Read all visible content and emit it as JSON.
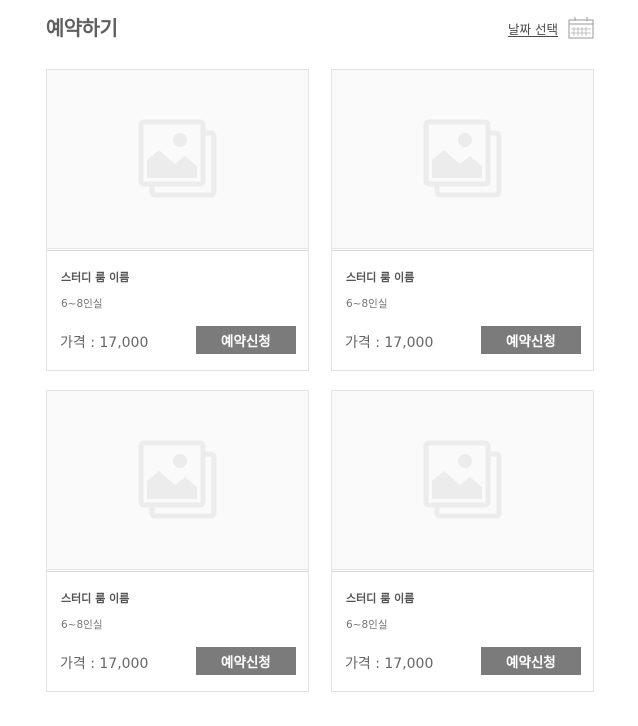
{
  "page": {
    "title": "예약하기",
    "date_select_label": "날짜 선택"
  },
  "icons": {
    "calendar": "calendar-icon",
    "image_placeholder": "image-placeholder-icon"
  },
  "colors": {
    "button_bg": "#7b7b7b",
    "button_text": "#ffffff",
    "title": "#5f5f5f",
    "card_border": "#e3e3e3",
    "image_bg": "#fafafa"
  },
  "rooms": [
    {
      "name": "스터디 룸 이름",
      "capacity": "6~8인실",
      "price": "가격 : 17,000",
      "button": "예약신청"
    },
    {
      "name": "스터디 룸 이름",
      "capacity": "6~8인실",
      "price": "가격 : 17,000",
      "button": "예약신청"
    },
    {
      "name": "스터디 룸 이름",
      "capacity": "6~8인실",
      "price": "가격 : 17,000",
      "button": "예약신청"
    },
    {
      "name": "스터디 룸 이름",
      "capacity": "6~8인실",
      "price": "가격 : 17,000",
      "button": "예약신청"
    }
  ]
}
